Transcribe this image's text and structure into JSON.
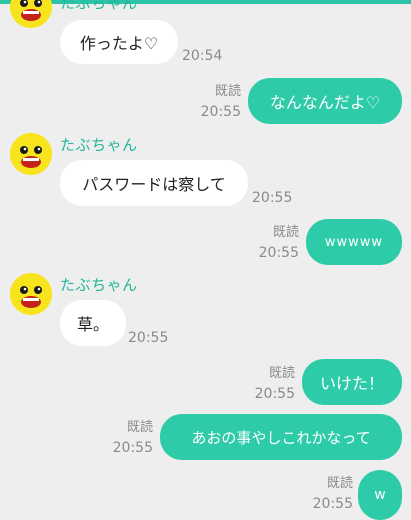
{
  "theme": {
    "accent": "#2ecba8",
    "sender_color": "#22b79a",
    "incoming_bubble": "#ffffff",
    "background": "#eeeeee"
  },
  "sender": {
    "name": "たぶちゃん",
    "avatar_icon": "yellow-character-avatar-icon"
  },
  "messages": [
    {
      "from": "them",
      "text": "作ったよ♡",
      "time": "20:54"
    },
    {
      "from": "me",
      "text": "なんなんだよ♡",
      "read": "既読",
      "time": "20:55"
    },
    {
      "from": "them",
      "name": "たぶちゃん",
      "text": "パスワードは察して",
      "time": "20:55"
    },
    {
      "from": "me",
      "text": "wwwww",
      "read": "既読",
      "time": "20:55"
    },
    {
      "from": "them",
      "name": "たぶちゃん",
      "text": "草。",
      "time": "20:55"
    },
    {
      "from": "me",
      "text": "いけた！",
      "read": "既読",
      "time": "20:55"
    },
    {
      "from": "me",
      "text": "あおの事やしこれかなって",
      "read": "既読",
      "time": "20:55"
    },
    {
      "from": "me",
      "text": "w",
      "read": "既読",
      "time": "20:55"
    }
  ]
}
